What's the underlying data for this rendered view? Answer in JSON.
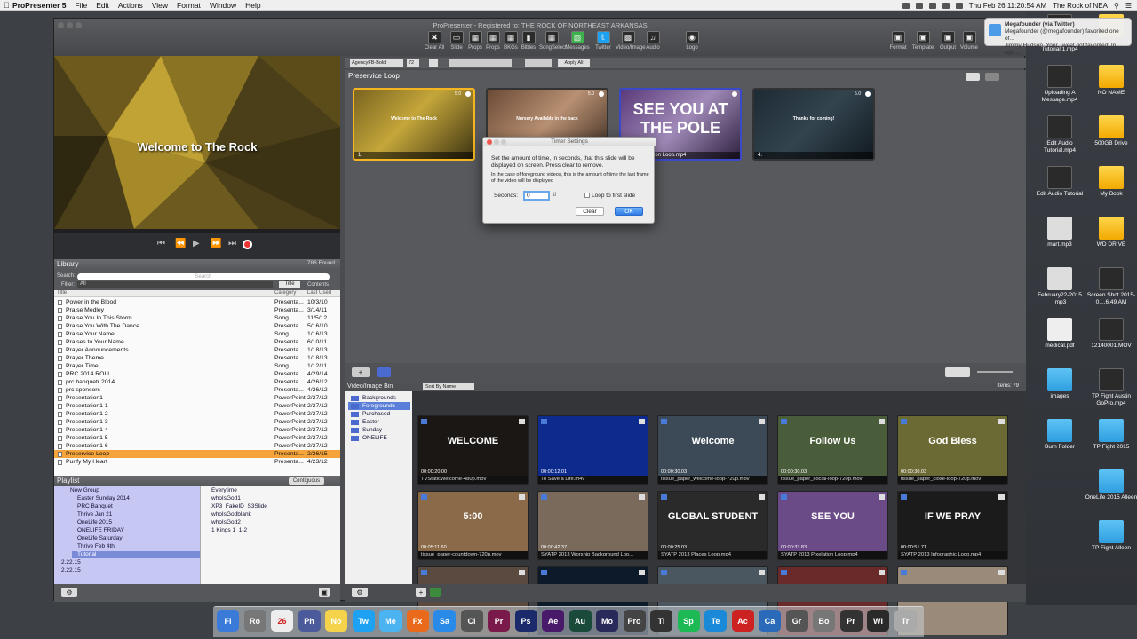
{
  "menubar": {
    "app_name": "ProPresenter 5",
    "items": [
      "File",
      "Edit",
      "Actions",
      "View",
      "Format",
      "Window",
      "Help"
    ],
    "clock": "Thu Feb 26  11:20:54 AM",
    "user": "The Rock of NEA"
  },
  "notification": {
    "source": "Megafounder (via Twitter)",
    "line1": "Megafounder (@megafounder) favorited one of...",
    "line2": "Jimmy Hudson. Your Tweet got favorited! In repl..."
  },
  "window": {
    "title": "ProPresenter - Registered to: THE ROCK OF NORTHEAST ARKANSAS"
  },
  "toolbar": {
    "buttons": [
      "Clear All",
      "Slide",
      "Props",
      "Props",
      "BKGs",
      "Bibles",
      "SongSelect",
      "Messages",
      "Twitter",
      "Video/Image",
      "Audio",
      "Logo"
    ],
    "right": [
      "Format",
      "Template",
      "Output",
      "Volume"
    ]
  },
  "formatbar": {
    "font": "AgencyFB-Bold",
    "size": "72",
    "apply": "Apply All"
  },
  "preview": {
    "text": "Welcome to The Rock"
  },
  "library": {
    "title": "Library",
    "count": "786 Found",
    "search_label": "Search:",
    "search_placeholder": "Search",
    "filter_label": "Filter:",
    "filter_value": "All",
    "tab_title": "Title",
    "tab_contents": "Contents",
    "columns": [
      "Title",
      "Category",
      "Last Used"
    ],
    "rows": [
      {
        "title": "Power in the Blood",
        "category": "Presenta...",
        "last": "10/3/10"
      },
      {
        "title": "Praise Medley",
        "category": "Presenta...",
        "last": "3/14/11"
      },
      {
        "title": "Praise You In This Storm",
        "category": "Song",
        "last": "11/5/12"
      },
      {
        "title": "Praise You With The Dance",
        "category": "Presenta...",
        "last": "5/16/10"
      },
      {
        "title": "Praise Your Name",
        "category": "Song",
        "last": "1/16/13"
      },
      {
        "title": "Praises to Your Name",
        "category": "Presenta...",
        "last": "6/10/11"
      },
      {
        "title": "Prayer Announcements",
        "category": "Presenta...",
        "last": "1/18/13"
      },
      {
        "title": "Prayer Theme",
        "category": "Presenta...",
        "last": "1/18/13"
      },
      {
        "title": "Prayer Time",
        "category": "Song",
        "last": "1/12/11"
      },
      {
        "title": "PRC 2014 ROLL",
        "category": "Presenta...",
        "last": "4/29/14"
      },
      {
        "title": "prc banquetr 2014",
        "category": "Presenta...",
        "last": "4/26/12"
      },
      {
        "title": "prc sponsors",
        "category": "Presenta...",
        "last": "4/26/12"
      },
      {
        "title": "Presentation1",
        "category": "PowerPoint",
        "last": "2/27/12"
      },
      {
        "title": "Presentation1 1",
        "category": "PowerPoint",
        "last": "2/27/12"
      },
      {
        "title": "Presentation1 2",
        "category": "PowerPoint",
        "last": "2/27/12"
      },
      {
        "title": "Presentation1 3",
        "category": "PowerPoint",
        "last": "2/27/12"
      },
      {
        "title": "Presentation1 4",
        "category": "PowerPoint",
        "last": "2/27/12"
      },
      {
        "title": "Presentation1 5",
        "category": "PowerPoint",
        "last": "2/27/12"
      },
      {
        "title": "Presentation1 6",
        "category": "PowerPoint",
        "last": "2/27/12"
      },
      {
        "title": "Preservice Loop",
        "category": "Presenta...",
        "last": "2/26/15"
      },
      {
        "title": "Purify My Heart",
        "category": "Presenta...",
        "last": "4/23/12"
      }
    ]
  },
  "playlist": {
    "title": "Playlist",
    "mode": "Contiguous",
    "groups": [
      "New Group",
      "Easter Sunday 2014",
      "PRC Banquet",
      "Thrive Jan 21",
      "OneLife 2015",
      "ONELIFE FRIDAY",
      "OneLife Saturday",
      "Thrive Feb 4th",
      "Tutorial",
      "2.22.15",
      "2.22.15"
    ],
    "items": [
      "Everytime",
      "whoIsGod1",
      "XP3_FakeID_S3Slide",
      "whoIsGodblank",
      "whoIsGod2",
      "1 Kings 1_1-2"
    ]
  },
  "slides": {
    "header": "Preservice Loop",
    "list": [
      {
        "text": "Welcome to The Rock",
        "label": "1.",
        "num": "5.0"
      },
      {
        "text": "Nursery Available in the back",
        "label": "",
        "num": "5.0"
      },
      {
        "text": "SEE YOU AT THE POLE",
        "label": "2013 Pixelation Loop.mp4",
        "num": ""
      },
      {
        "text": "Thanks for coming!",
        "label": "4.",
        "num": "5.0"
      }
    ]
  },
  "dialog": {
    "title": "Timer Settings",
    "message": "Set the amount of time, in seconds, that this slide will be displayed on screen. Press clear to remove.",
    "sub": "In the case of foreground videos, this is the amount of time the last frame of the video will be displayed",
    "seconds_label": "Seconds:",
    "seconds_value": "0",
    "loop_label": "Loop to first slide",
    "clear": "Clear",
    "ok": "OK"
  },
  "bin": {
    "title": "Video/Image Bin",
    "sort": "Sort By Name",
    "count": "Items: 79",
    "categories": [
      "Backgrounds",
      "Foregrounds",
      "Purchased",
      "Easter",
      "Sunday",
      "ONELIFE"
    ],
    "items": [
      {
        "big": "WELCOME",
        "time": "00:00:20.00",
        "name": "TVStaticWelcome-480p.mov"
      },
      {
        "big": "",
        "time": "00:00:12.01",
        "name": "To Save a Life.m4v"
      },
      {
        "big": "Welcome",
        "time": "00:00:30.03",
        "name": "tissue_paper_welcome-loop-720p.mov"
      },
      {
        "big": "Follow Us",
        "time": "00:00:30.03",
        "name": "tissue_paper_social-loop-720p.mov"
      },
      {
        "big": "God Bless",
        "time": "00:00:30.03",
        "name": "tissue_paper_close-loop-720p.mov"
      },
      {
        "big": "5:00",
        "time": "00:05:11.60",
        "name": "tissue_paper-countdown-720p.mov"
      },
      {
        "big": "",
        "time": "00:00:42.37",
        "name": "SYATP 2013 Worship Background Loo..."
      },
      {
        "big": "GLOBAL STUDENT",
        "time": "00:00:25.03",
        "name": "SYATP 2013 Places Loop.mp4"
      },
      {
        "big": "SEE YOU",
        "time": "00:00:33.83",
        "name": "SYATP 2013 Pixelation Loop.mp4"
      },
      {
        "big": "IF WE PRAY",
        "time": "00:00:51.71",
        "name": "SYATP 2013 Infographic Loop.mp4"
      },
      {
        "big": "IF WHO ARE",
        "time": "",
        "name": ""
      },
      {
        "big": "SYATP",
        "time": "",
        "name": ""
      },
      {
        "big": "",
        "time": "",
        "name": ""
      },
      {
        "big": "",
        "time": "",
        "name": ""
      },
      {
        "big": "",
        "time": "",
        "name": ""
      }
    ]
  },
  "desktop": [
    {
      "label": "ProPresenter Tutorial 1.mp4",
      "kind": "vid"
    },
    {
      "label": "Macintosh HD",
      "kind": "drive"
    },
    {
      "label": "Uploading A Message.mp4",
      "kind": "vid"
    },
    {
      "label": "NO NAME",
      "kind": "drive"
    },
    {
      "label": "Edit Audio Tutorial.mp4",
      "kind": "vid"
    },
    {
      "label": "500GB Drive",
      "kind": "drive"
    },
    {
      "label": "Edit Audio Tutorial",
      "kind": "vid"
    },
    {
      "label": "My Book",
      "kind": "drive"
    },
    {
      "label": "mart.mp3",
      "kind": "song"
    },
    {
      "label": "WD DRIVE",
      "kind": "drive"
    },
    {
      "label": "February22-2015 .mp3",
      "kind": "song"
    },
    {
      "label": "Screen Shot 2015-0....6.49 AM",
      "kind": "vid"
    },
    {
      "label": "medical.pdf",
      "kind": "doc"
    },
    {
      "label": "12140001.MOV",
      "kind": "vid"
    },
    {
      "label": "images",
      "kind": "folder"
    },
    {
      "label": "TP Fight Austin GoPro.mp4",
      "kind": "vid"
    },
    {
      "label": "Burn Folder",
      "kind": "folder"
    },
    {
      "label": "TP Fight  2015",
      "kind": "folder"
    },
    {
      "label": "",
      "kind": "none"
    },
    {
      "label": "OneLife 2015 Alleen",
      "kind": "folder"
    },
    {
      "label": "",
      "kind": "none"
    },
    {
      "label": "TP Fight Alleen",
      "kind": "folder"
    }
  ],
  "dock": [
    "Fi",
    "Ro",
    "26",
    "Ph",
    "No",
    "Tw",
    "Me",
    "Fx",
    "Sa",
    "Cl",
    "Pr",
    "Ps",
    "Ae",
    "Au",
    "Mo",
    "Pro",
    "Ti",
    "Sp",
    "Te",
    "Ac",
    "Ca",
    "Gr",
    "Bo",
    "Pr",
    "Wi",
    "Tr"
  ]
}
